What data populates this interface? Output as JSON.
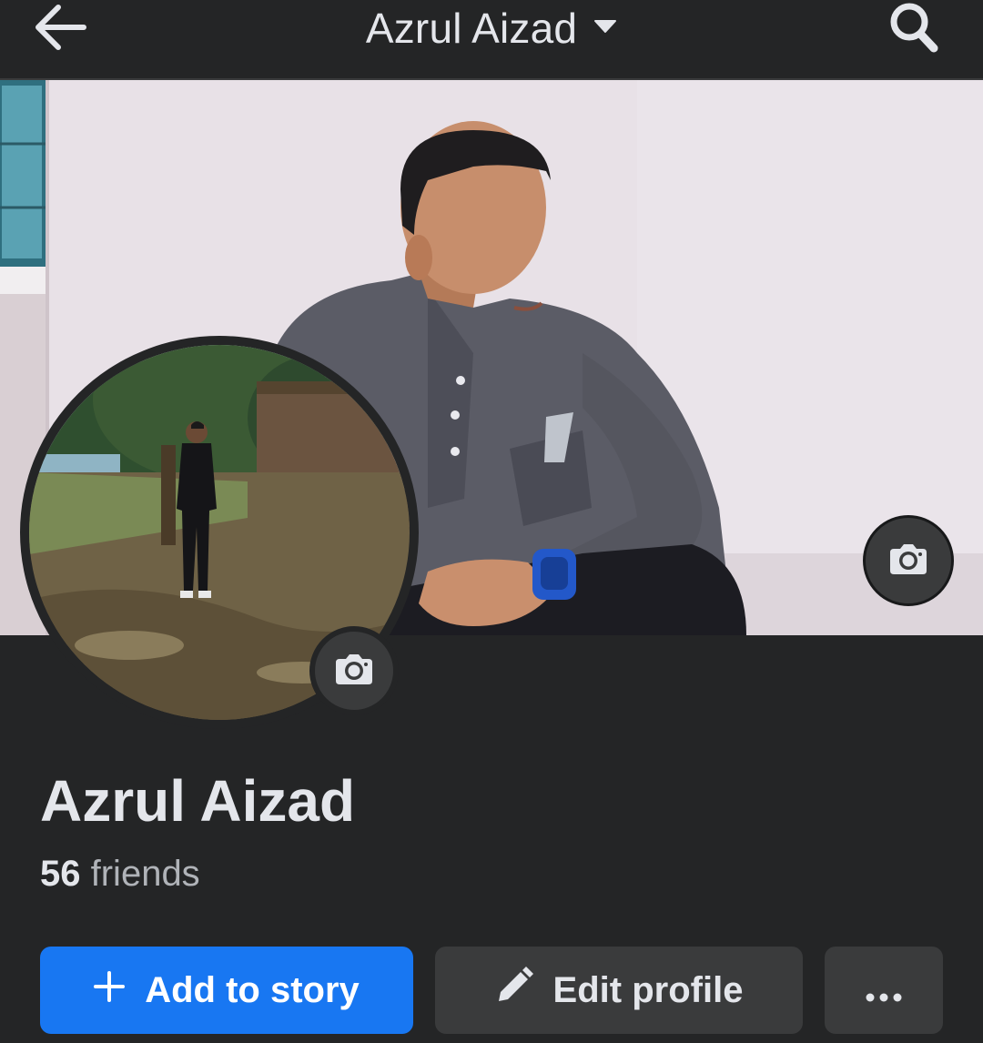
{
  "header": {
    "title": "Azrul Aizad",
    "back_icon": "arrow-left-icon",
    "dropdown_icon": "caret-down-icon",
    "search_icon": "search-icon"
  },
  "cover": {
    "camera_icon": "camera-icon"
  },
  "avatar": {
    "camera_icon": "camera-icon"
  },
  "profile": {
    "name": "Azrul Aizad",
    "friends_count": "56",
    "friends_label": "friends"
  },
  "actions": {
    "add_story_label": "Add to story",
    "edit_profile_label": "Edit profile",
    "more_icon": "more-dots-icon"
  },
  "colors": {
    "background": "#242526",
    "primary_button": "#1877f2",
    "secondary_button": "#3a3b3c",
    "text_primary": "#e4e6eb",
    "text_secondary": "#b0b3b8"
  }
}
